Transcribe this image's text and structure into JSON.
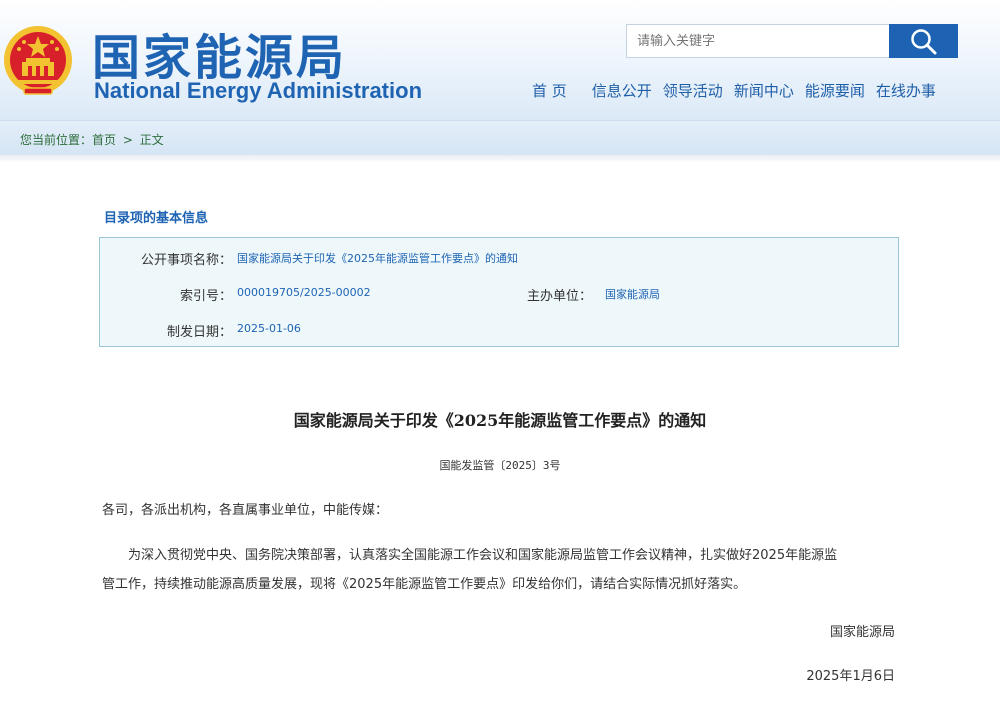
{
  "header": {
    "title_cn": "国家能源局",
    "title_en": "National Energy Administration"
  },
  "search": {
    "placeholder": "请输入关键字"
  },
  "nav": {
    "items": [
      "首 页",
      "信息公开",
      "领导活动",
      "新闻中心",
      "能源要闻",
      "在线办事"
    ]
  },
  "breadcrumb": {
    "prefix": "您当前位置：",
    "home": "首页",
    "sep": ">",
    "current": "正文"
  },
  "info": {
    "section_title": "目录项的基本信息",
    "name_label": "公开事项名称：",
    "name_value": "国家能源局关于印发《2025年能源监管工作要点》的通知",
    "index_label": "索引号：",
    "index_value": "000019705/2025-00002",
    "org_label": "主办单位：",
    "org_value": "国家能源局",
    "date_label": "制发日期：",
    "date_value": "2025-01-06"
  },
  "document": {
    "title": "国家能源局关于印发《2025年能源监管工作要点》的通知",
    "number": "国能发监管〔2025〕3号",
    "salutation": "各司，各派出机构，各直属事业单位，中能传媒：",
    "body_line1": "为深入贯彻党中央、国务院决策部署，认真落实全国能源工作会议和国家能源局监管工作会议精神，扎实做好2025年能源监",
    "body_line2": "管工作，持续推动能源高质量发展，现将《2025年能源监管工作要点》印发给你们，请结合实际情况抓好落实。",
    "signature": "国家能源局",
    "date": "2025年1月6日"
  },
  "colors": {
    "brand_blue": "#1f64b3",
    "emblem_red": "#d8202a",
    "emblem_gold": "#f2c230"
  }
}
